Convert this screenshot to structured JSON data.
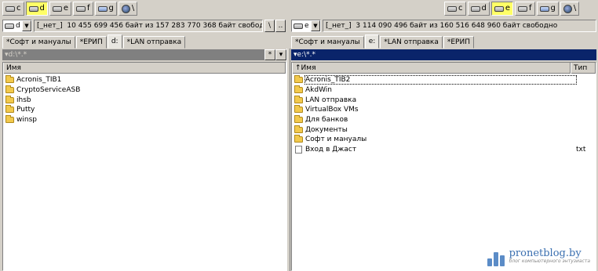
{
  "left": {
    "drives": [
      {
        "letter": "c",
        "active": false,
        "icon": "disk-drive-icon"
      },
      {
        "letter": "d",
        "active": true,
        "icon": "disk-drive-icon"
      },
      {
        "letter": "e",
        "active": false,
        "icon": "disk-drive-icon"
      },
      {
        "letter": "f",
        "active": false,
        "icon": "disk-drive-icon"
      },
      {
        "letter": "g",
        "active": false,
        "icon": "network-drive-icon"
      },
      {
        "letter": "\\",
        "active": false,
        "icon": "network-globe-icon"
      }
    ],
    "combo_drive": "d",
    "label": "[_нет_]",
    "space_info": "10 455 699 456 байт из 157 283 770 368 байт свободно",
    "root_btn": "\\",
    "up_btn": "..",
    "tabs": [
      {
        "label": "*Софт и мануалы",
        "active": false
      },
      {
        "label": "*ЕРИП",
        "active": false
      },
      {
        "label": "d:",
        "active": true
      },
      {
        "label": "*LAN отправка",
        "active": false
      }
    ],
    "path": "d:\\*.*",
    "path_btn_star": "*",
    "path_btn_down": "▾",
    "col_name": "Имя",
    "files": [
      {
        "name": "Acronis_TIB1",
        "type": "folder",
        "ext": ""
      },
      {
        "name": "CryptoServiceASB",
        "type": "folder",
        "ext": ""
      },
      {
        "name": "ihsb",
        "type": "folder",
        "ext": ""
      },
      {
        "name": "Putty",
        "type": "folder",
        "ext": ""
      },
      {
        "name": "winsp",
        "type": "folder",
        "ext": ""
      }
    ]
  },
  "right": {
    "drives": [
      {
        "letter": "c",
        "active": false,
        "icon": "disk-drive-icon"
      },
      {
        "letter": "d",
        "active": false,
        "icon": "disk-drive-icon"
      },
      {
        "letter": "e",
        "active": true,
        "icon": "disk-drive-icon"
      },
      {
        "letter": "f",
        "active": false,
        "icon": "disk-drive-icon"
      },
      {
        "letter": "g",
        "active": false,
        "icon": "network-drive-icon"
      },
      {
        "letter": "\\",
        "active": false,
        "icon": "network-globe-icon"
      }
    ],
    "combo_drive": "e",
    "label": "[_нет_]",
    "space_info": "3 114 090 496 байт из 160 516 648 960 байт свободно",
    "tabs": [
      {
        "label": "*Софт и мануалы",
        "active": false
      },
      {
        "label": "e:",
        "active": true
      },
      {
        "label": "*LAN отправка",
        "active": false
      },
      {
        "label": "*ЕРИП",
        "active": false
      }
    ],
    "path": "e:\\*.*",
    "col_name": "↑Имя",
    "col_type": "Тип",
    "files": [
      {
        "name": "Acronis_TIB2",
        "type": "folder",
        "ext": ""
      },
      {
        "name": "AkdWin",
        "type": "folder",
        "ext": ""
      },
      {
        "name": "LAN отправка",
        "type": "folder",
        "ext": ""
      },
      {
        "name": "VirtualBox VMs",
        "type": "folder",
        "ext": ""
      },
      {
        "name": "Для банков",
        "type": "folder",
        "ext": ""
      },
      {
        "name": "Документы",
        "type": "folder",
        "ext": ""
      },
      {
        "name": "Софт и мануалы",
        "type": "folder",
        "ext": ""
      },
      {
        "name": "Вход в Джаст",
        "type": "file",
        "ext": "txt"
      }
    ]
  },
  "watermark": {
    "site": "pronetblog.by",
    "tagline": "блог компьютерного энтузиаста"
  },
  "colors": {
    "active_drive": "#ffff66",
    "active_path": "#0a246a",
    "inactive_path": "#808080",
    "folder": "#f2c94c"
  }
}
